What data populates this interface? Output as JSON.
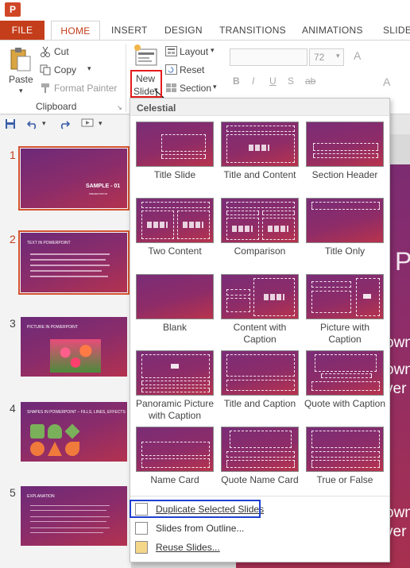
{
  "app": {
    "icon_letter": "P"
  },
  "tabs": [
    {
      "label": "FILE"
    },
    {
      "label": "HOME"
    },
    {
      "label": "INSERT"
    },
    {
      "label": "DESIGN"
    },
    {
      "label": "TRANSITIONS"
    },
    {
      "label": "ANIMATIONS"
    },
    {
      "label": "SLIDE S"
    }
  ],
  "clipboard": {
    "paste": "Paste",
    "cut": "Cut",
    "copy": "Copy",
    "format_painter": "Format Painter",
    "group_label": "Clipboard"
  },
  "slides_group": {
    "new_slide_line1": "New",
    "new_slide_line2": "Slide",
    "layout": "Layout",
    "reset": "Reset",
    "section": "Section"
  },
  "font": {
    "size": "72",
    "bold": "B",
    "italic": "I",
    "underline": "U",
    "strike": "S",
    "shadow": "ab",
    "grow": "A"
  },
  "gallery": {
    "theme": "Celestial",
    "layouts": [
      {
        "label": "Title Slide"
      },
      {
        "label": "Title and Content"
      },
      {
        "label": "Section Header"
      },
      {
        "label": "Two Content"
      },
      {
        "label": "Comparison"
      },
      {
        "label": "Title Only"
      },
      {
        "label": "Blank"
      },
      {
        "label": "Content with Caption"
      },
      {
        "label": "Picture with Caption"
      },
      {
        "label": "Panoramic Picture with Caption"
      },
      {
        "label": "Title and Caption"
      },
      {
        "label": "Quote with Caption"
      },
      {
        "label": "Name Card"
      },
      {
        "label": "Quote Name Card"
      },
      {
        "label": "True or False"
      }
    ],
    "menu": [
      {
        "label": "Duplicate Selected Slides"
      },
      {
        "label": "Slides from Outline..."
      },
      {
        "label": "Reuse Slides..."
      }
    ]
  },
  "thumbnails": [
    {
      "num": "1",
      "text": "SAMPLE - 01",
      "sub": "PRESENTATION"
    },
    {
      "num": "2",
      "text": "TEXT IN POWERPOINT"
    },
    {
      "num": "3",
      "text": "PICTURE IN POWERPOINT"
    },
    {
      "num": "4",
      "text": "SHAPES IN POWERPOINT – FILLS, LINES, EFFECTS"
    },
    {
      "num": "5",
      "text": "EXPLANATION"
    }
  ],
  "main_slide": {
    "title_fragment": "P",
    "line1": "own",
    "line2": "own",
    "line3": "ver t",
    "line4": "own",
    "line5": "ver t"
  }
}
